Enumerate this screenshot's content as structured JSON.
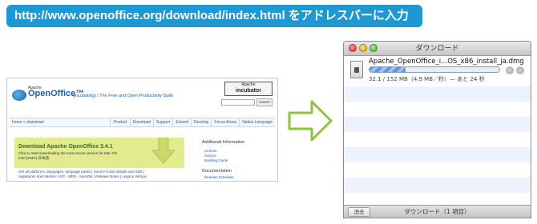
{
  "banner": {
    "text": "http://www.openoffice.org/download/index.html をアドレスバーに入力",
    "color": "#1d98d3"
  },
  "site": {
    "logo_small": "Apache",
    "logo_text": "OpenOffice™",
    "tagline": "(incubating) | The Free and Open Productivity Suite",
    "incubator_top": "Apache",
    "incubator_main": "incubator",
    "search_button": "search",
    "breadcrumb": "home » download",
    "nav": [
      "Product",
      "Download",
      "Support",
      "Extend",
      "Develop",
      "Focus Areas",
      "Native Language"
    ],
    "download_title": "Download Apache OpenOffice 3.4.1",
    "download_desc": "Click to start downloading the most recent version for Mac OS Intel (DMG) 日本語.",
    "links_line1": "Get all platforms, languages, language packs | Source Code tarballs and SDK |",
    "links_line2": "Signatures and Hashes: ASC - MD5 - SHA256 | Release Notes | Legacy Version",
    "additional_title": "Additional Information",
    "additional_links": [
      "License",
      "Source",
      "Building Guide"
    ],
    "documentation_title": "Documentation",
    "documentation_links": [
      "Release Schedule"
    ],
    "download_box_color": "#e2eb8d"
  },
  "downloads": {
    "title": "ダウンロード",
    "filename": "Apache_OpenOffice_i...OS_x86_install_ja.dmg",
    "progress_fraction": 0.28,
    "status": "32.1 / 152 MB（4.9 MB／秒）— あと 24 秒",
    "stop_icon": "stop-icon",
    "reveal_icon": "magnifier-icon",
    "clear_button": "消去",
    "footer": "ダウンロード（1 項目）"
  },
  "arrow_color": "#8ec33e"
}
